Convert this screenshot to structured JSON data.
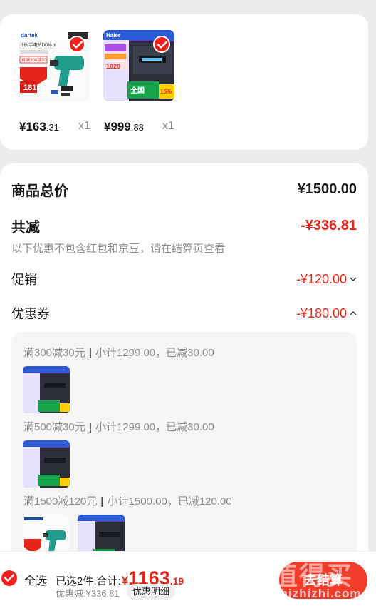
{
  "products": [
    {
      "brand": "dartek",
      "name_text": "16V手电钻DDN-m",
      "promo_text": "有满300减30",
      "price_tag": "181",
      "price_int": "¥163",
      "price_dec": ".31",
      "qty": "x1",
      "image_icon": "drill-product-image"
    },
    {
      "brand": "Haier",
      "price_tag": "1020",
      "promo_text": "全国",
      "promo_pct": "15%",
      "price_int": "¥999",
      "price_dec": ".88",
      "qty": "x1",
      "image_icon": "water-heater-product-image"
    }
  ],
  "summary": {
    "goods_total_label": "商品总价",
    "goods_total_value": "¥1500.00",
    "reduce_label": "共减",
    "reduce_value": "-¥336.81",
    "note": "以下优惠不包含红包和京豆，请在结算页查看",
    "promo_label": "促销",
    "promo_value": "-¥120.00",
    "coupon_label": "优惠券",
    "coupon_value": "-¥180.00"
  },
  "coupons": [
    {
      "title": "满300减30元",
      "detail": "小计1299.00，已减30.00"
    },
    {
      "title": "满500减30元",
      "detail": "小计1299.00，已减30.00"
    },
    {
      "title": "满1500减120元",
      "detail": "小计1500.00，已减120.00"
    }
  ],
  "bottom": {
    "select_all": "全选",
    "selected_text": "已选2件,合计:",
    "total_symbol": "¥",
    "total_int": "1163",
    "total_dec": ".19",
    "discount_text": "优惠减:¥336.81",
    "detail_button": "优惠明细",
    "checkout_button": "去结算"
  },
  "watermark": {
    "text": "值得买",
    "url": "zhizhizhi.com"
  },
  "colors": {
    "accent_red": "#e5261b",
    "badge_red": "#f0201c",
    "checkout_red": "#f23c2a"
  }
}
